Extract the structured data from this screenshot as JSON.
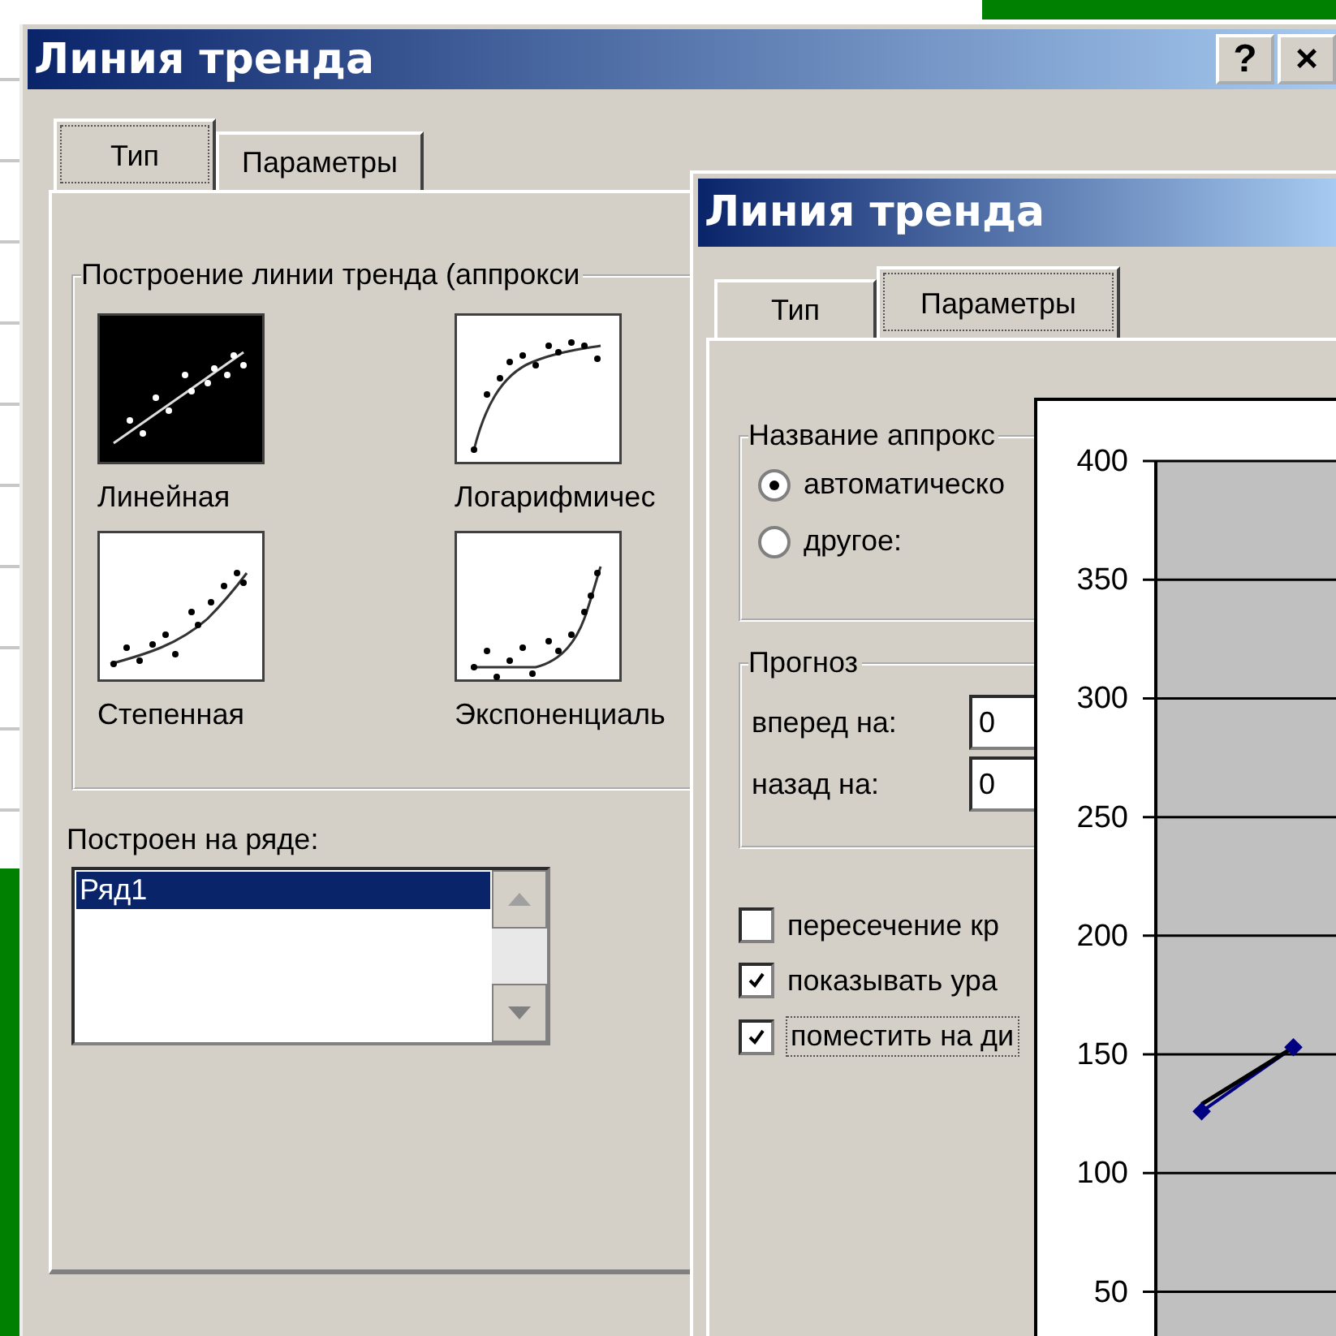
{
  "back_dialog": {
    "title": "Линия тренда",
    "title_buttons": [
      "?",
      "×"
    ],
    "tabs": [
      {
        "label": "Тип",
        "selected": true
      },
      {
        "label": "Параметры",
        "selected": false
      }
    ],
    "trend_group": {
      "label": "Построение линии тренда (аппрокси",
      "types": [
        {
          "kind": "linear",
          "label": "Линейная",
          "selected": true
        },
        {
          "kind": "logarithmic",
          "label": "Логарифмичес",
          "selected": false
        },
        {
          "kind": "power",
          "label": "Степенная",
          "selected": false
        },
        {
          "kind": "exponential",
          "label": "Экспоненциаль",
          "selected": false
        }
      ]
    },
    "series_list": {
      "label": "Построен на ряде:",
      "items": [
        {
          "label": "Ряд1",
          "selected": true
        }
      ]
    }
  },
  "front_dialog": {
    "title": "Линия тренда",
    "tabs": [
      {
        "label": "Тип",
        "selected": false
      },
      {
        "label": "Параметры",
        "selected": true
      }
    ],
    "name_group": {
      "label": "Название аппрокс",
      "options": [
        {
          "label": "автоматическо",
          "selected": true
        },
        {
          "label": "другое:",
          "selected": false
        }
      ]
    },
    "forecast_group": {
      "label": "Прогноз",
      "fields": [
        {
          "label": "вперед на:",
          "value": "0"
        },
        {
          "label": "назад на:",
          "value": "0"
        }
      ]
    },
    "checkboxes": [
      {
        "label": "пересечение кр",
        "checked": false
      },
      {
        "label": "показывать ура",
        "checked": true
      },
      {
        "label": "поместить на ди",
        "checked": true
      }
    ]
  },
  "chart_window": {
    "chart_data": {
      "type": "line",
      "ylim": [
        30,
        400
      ],
      "yticks": [
        50,
        100,
        150,
        200,
        250,
        300,
        350,
        400
      ],
      "grid": true,
      "categories": [
        null,
        null
      ],
      "series": [
        {
          "color": "#000080",
          "marker": "diamond",
          "values": [
            126,
            153
          ]
        },
        {
          "color": "#000000",
          "values": [
            129,
            153
          ]
        }
      ]
    }
  }
}
